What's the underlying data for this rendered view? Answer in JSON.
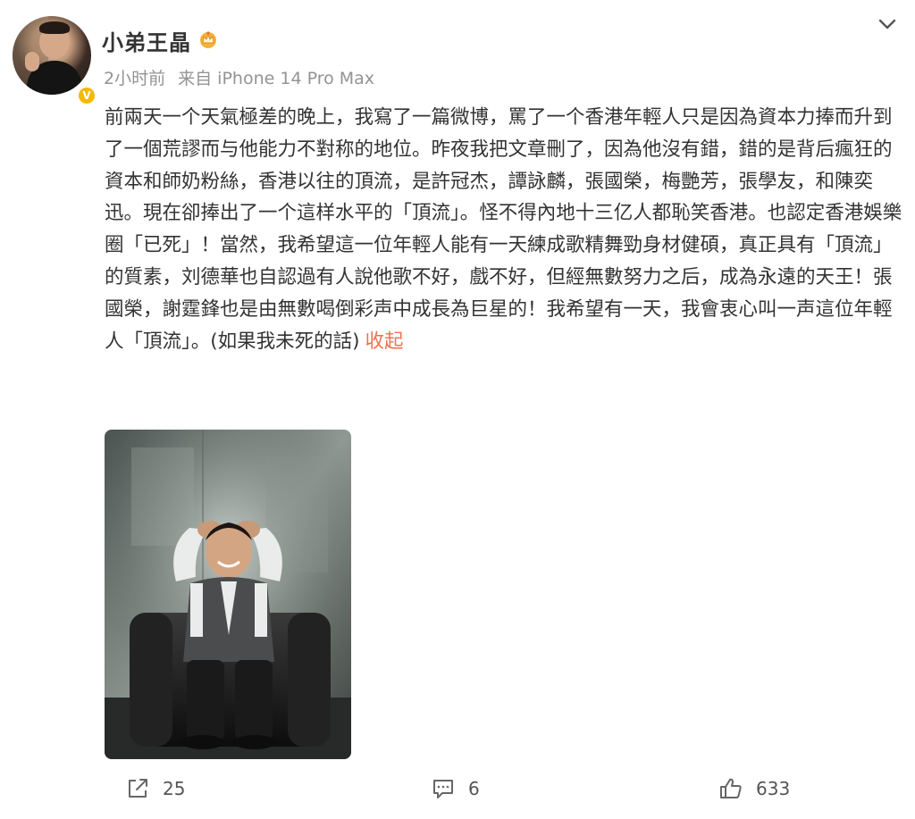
{
  "user": {
    "name": "小弟王晶",
    "verified_badge": "V"
  },
  "post": {
    "time": "2小时前",
    "source": "来自 iPhone 14 Pro Max",
    "text": "前兩天一个天氣極差的晚上，我寫了一篇微博，罵了一个香港年輕人只是因為資本力捧而升到了一個荒謬而与他能力不對称的地位。昨夜我把文章刪了，因為他沒有錯，錯的是背后瘋狂的資本和師奶粉絲，香港以往的頂流，是許冠杰，譚詠麟，張國榮，梅艷芳，張學友，和陳奕迅。現在卻捧出了一个這样水平的「頂流」。怪不得內地十三亿人都恥笑香港。也認定香港娛樂圈「已死」！當然，我希望這一位年輕人能有一天練成歌精舞勁身材健碩，真正具有「頂流」的質素，刘德華也自認過有人說他歌不好，戲不好，但經無數努力之后，成為永遠的天王！張國榮，謝霆鋒也是由無數喝倒彩声中成長為巨星的！我希望有一天，我會衷心叫一声這位年輕人「頂流」。(如果我未死的話)",
    "collapse_label": "收起"
  },
  "actions": {
    "share_count": "25",
    "comment_count": "6",
    "like_count": "633"
  },
  "icons": {
    "vip": "vip-crown-icon",
    "menu": "chevron-down-icon",
    "share": "share-icon",
    "comment": "comment-icon",
    "like": "thumbs-up-icon"
  },
  "colors": {
    "link": "#eb7350",
    "meta": "#939393",
    "badge": "#f5b900"
  }
}
